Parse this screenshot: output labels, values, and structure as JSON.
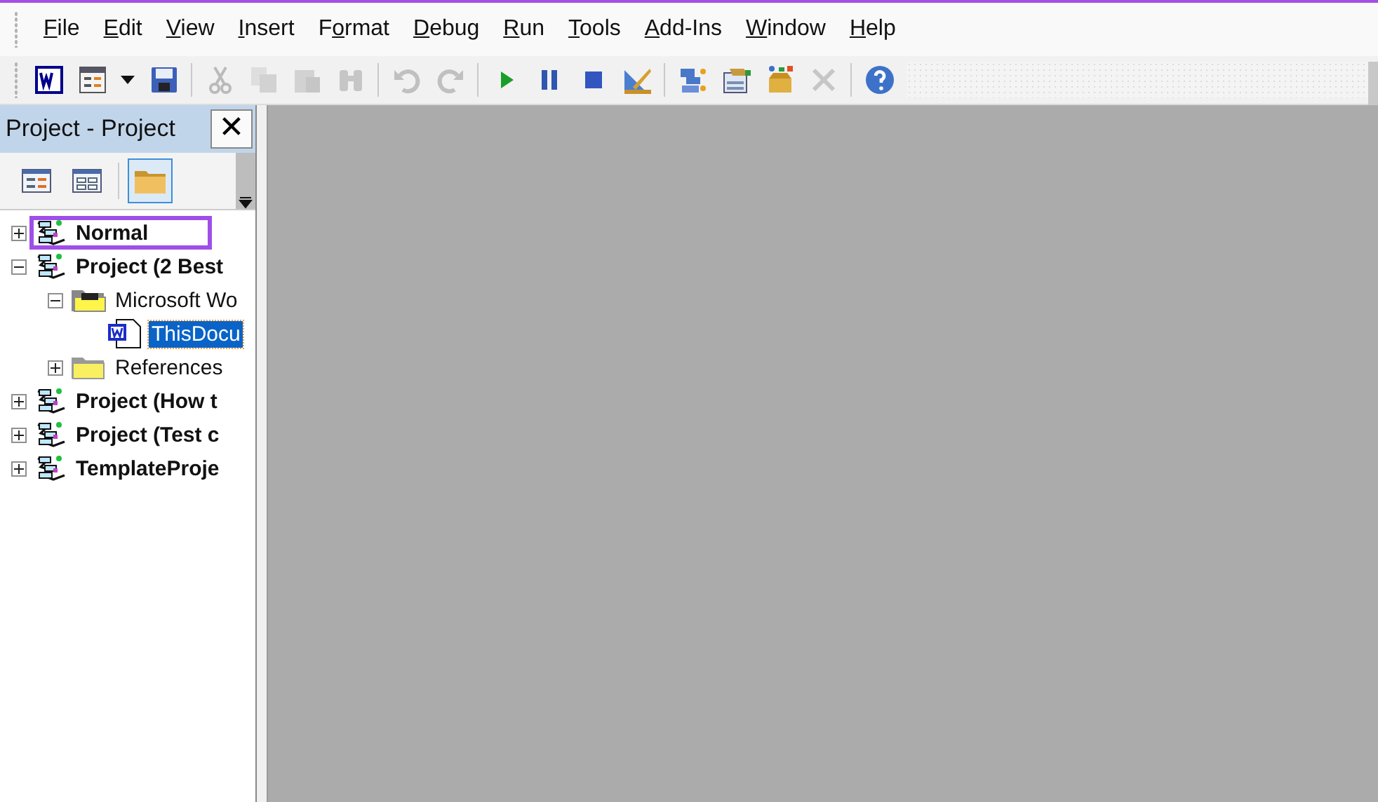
{
  "menu": [
    {
      "key": "F",
      "post": "ile"
    },
    {
      "key": "E",
      "post": "dit"
    },
    {
      "key": "V",
      "post": "iew"
    },
    {
      "key": "I",
      "post": "nsert"
    },
    {
      "pre": "F",
      "key": "o",
      "post": "rmat"
    },
    {
      "key": "D",
      "post": "ebug"
    },
    {
      "key": "R",
      "post": "un"
    },
    {
      "key": "T",
      "post": "ools"
    },
    {
      "key": "A",
      "post": "dd-Ins"
    },
    {
      "key": "W",
      "post": "indow"
    },
    {
      "key": "H",
      "post": "elp"
    }
  ],
  "toolbar": [
    {
      "kind": "word",
      "disabled": false
    },
    {
      "kind": "form",
      "disabled": false
    },
    {
      "kind": "caret",
      "disabled": false
    },
    {
      "kind": "save",
      "disabled": false
    },
    {
      "kind": "sep"
    },
    {
      "kind": "cut",
      "disabled": true
    },
    {
      "kind": "copy",
      "disabled": true
    },
    {
      "kind": "paste",
      "disabled": true
    },
    {
      "kind": "find",
      "disabled": true
    },
    {
      "kind": "sep"
    },
    {
      "kind": "undo",
      "disabled": true
    },
    {
      "kind": "redo",
      "disabled": true
    },
    {
      "kind": "sep"
    },
    {
      "kind": "run",
      "disabled": false
    },
    {
      "kind": "pause",
      "disabled": false
    },
    {
      "kind": "stop",
      "disabled": false
    },
    {
      "kind": "design",
      "disabled": false
    },
    {
      "kind": "sep"
    },
    {
      "kind": "explorer",
      "disabled": false
    },
    {
      "kind": "properties",
      "disabled": false
    },
    {
      "kind": "browser",
      "disabled": false
    },
    {
      "kind": "toolbox",
      "disabled": true
    },
    {
      "kind": "sep"
    },
    {
      "kind": "help",
      "disabled": false
    }
  ],
  "project_panel": {
    "title": "Project - Project",
    "close": "✕",
    "buttons": [
      {
        "kind": "code",
        "selected": false
      },
      {
        "kind": "object",
        "selected": false
      },
      {
        "kind": "folders",
        "selected": true
      }
    ],
    "tree": [
      {
        "label": "Normal",
        "kind": "project",
        "bold": true,
        "expanded": false,
        "selected": false,
        "highlighted": true
      },
      {
        "label": "Project (2 Best",
        "kind": "project",
        "bold": true,
        "expanded": true,
        "selected": false,
        "highlighted": false,
        "children": [
          {
            "label": "Microsoft Wo",
            "kind": "folder-open",
            "bold": false,
            "expanded": true,
            "selected": false,
            "highlighted": false,
            "children": [
              {
                "label": "ThisDocu",
                "kind": "document",
                "bold": false,
                "selected": true,
                "highlighted": false
              }
            ]
          },
          {
            "label": "References",
            "kind": "folder",
            "bold": false,
            "expanded": false,
            "selected": false,
            "highlighted": false
          }
        ]
      },
      {
        "label": "Project (How t",
        "kind": "project",
        "bold": true,
        "expanded": false,
        "selected": false,
        "highlighted": false
      },
      {
        "label": "Project (Test c",
        "kind": "project",
        "bold": true,
        "expanded": false,
        "selected": false,
        "highlighted": false
      },
      {
        "label": "TemplateProje",
        "kind": "project",
        "bold": true,
        "expanded": false,
        "selected": false,
        "highlighted": false
      }
    ]
  }
}
